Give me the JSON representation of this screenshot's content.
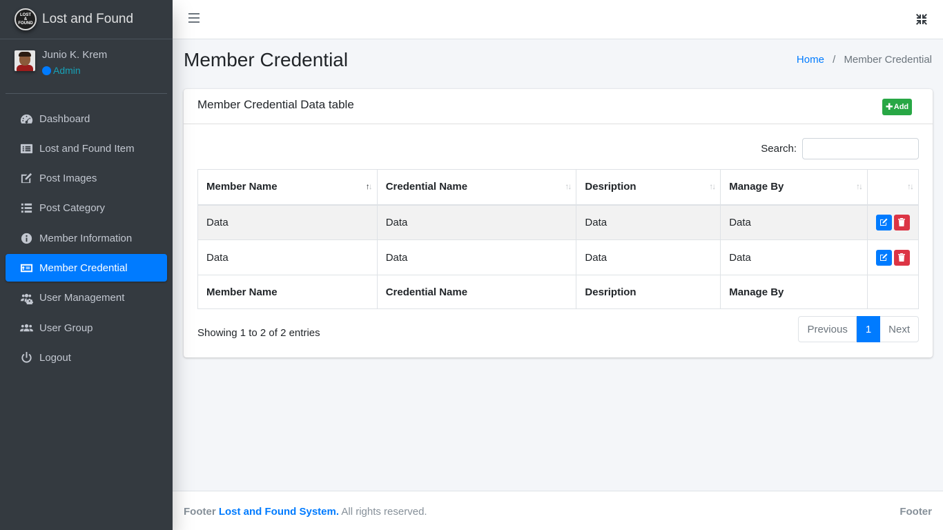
{
  "brand": {
    "name": "Lost and Found",
    "logo_text": "LOST & FOUND"
  },
  "user": {
    "name": "Junio K. Krem",
    "role": "Admin"
  },
  "sidebar": {
    "items": [
      {
        "label": "Dashboard",
        "icon": "tachometer-icon"
      },
      {
        "label": "Lost and Found Item",
        "icon": "list-alt-icon"
      },
      {
        "label": "Post Images",
        "icon": "edit-icon"
      },
      {
        "label": "Post Category",
        "icon": "list-icon"
      },
      {
        "label": "Member Information",
        "icon": "info-circle-icon"
      },
      {
        "label": "Member Credential",
        "icon": "id-card-icon",
        "active": true
      },
      {
        "label": "User Management",
        "icon": "users-cog-icon"
      },
      {
        "label": "User Group",
        "icon": "users-icon"
      },
      {
        "label": "Logout",
        "icon": "power-off-icon"
      }
    ]
  },
  "page": {
    "title": "Member Credential",
    "breadcrumb": {
      "home": "Home",
      "separator": "/",
      "current": "Member Credential"
    }
  },
  "card": {
    "title": "Member Credential Data table",
    "add_label": "Add",
    "search_label": "Search:",
    "search_value": ""
  },
  "table": {
    "columns": [
      "Member Name",
      "Credential Name",
      "Desription",
      "Manage By",
      ""
    ],
    "rows": [
      [
        "Data",
        "Data",
        "Data",
        "Data"
      ],
      [
        "Data",
        "Data",
        "Data",
        "Data"
      ]
    ],
    "footer_columns": [
      "Member Name",
      "Credential Name",
      "Desription",
      "Manage By",
      ""
    ]
  },
  "pagination": {
    "info": "Showing 1 to 2 of 2 entries",
    "previous": "Previous",
    "current": "1",
    "next": "Next"
  },
  "footer": {
    "prefix": "Footer",
    "link": "Lost and Found System.",
    "suffix": "All rights reserved.",
    "right": "Footer"
  },
  "colors": {
    "primary": "#007bff",
    "success": "#28a745",
    "danger": "#dc3545",
    "sidebar": "#343a40"
  }
}
